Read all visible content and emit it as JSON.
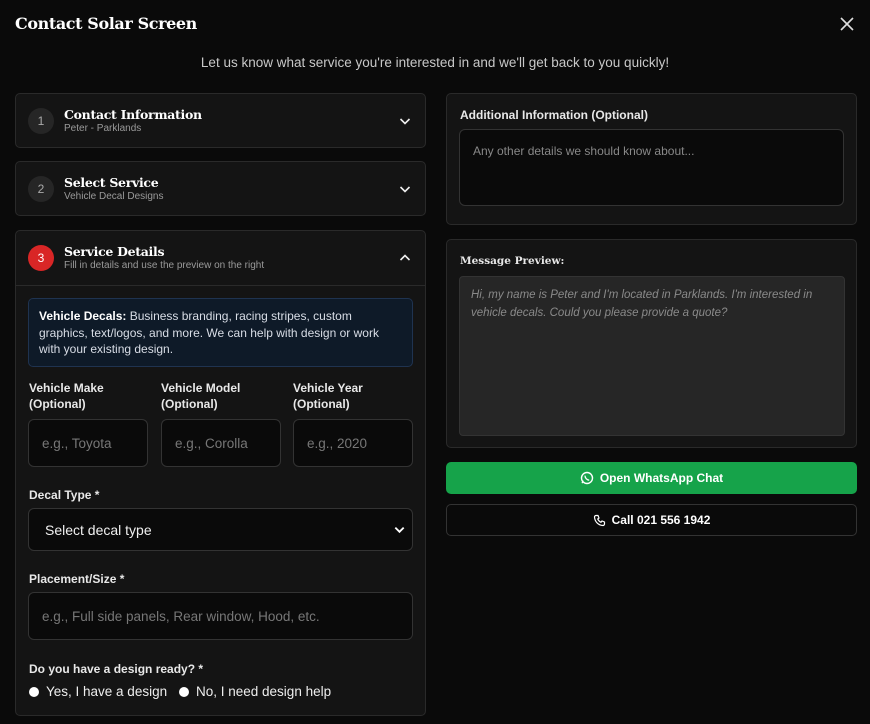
{
  "dialog": {
    "title": "Contact Solar Screen",
    "subtitle": "Let us know what service you're interested in and we'll get back to you quickly!"
  },
  "steps": [
    {
      "number": "1",
      "title": "Contact Information",
      "subtitle": "Peter - Parklands",
      "state": "collapsed"
    },
    {
      "number": "2",
      "title": "Select Service",
      "subtitle": "Vehicle Decal Designs",
      "state": "collapsed"
    },
    {
      "number": "3",
      "title": "Service Details",
      "subtitle": "Fill in details and use the preview on the right",
      "state": "expanded"
    }
  ],
  "service_details": {
    "info_heading": "Vehicle Decals:",
    "info_text": " Business branding, racing stripes, custom graphics, text/logos, and more. We can help with design or work with your existing design.",
    "vehicle_make": {
      "label_line1": "Vehicle Make",
      "label_line2": "(Optional)",
      "placeholder": "e.g., Toyota"
    },
    "vehicle_model": {
      "label_line1": "Vehicle Model",
      "label_line2": "(Optional)",
      "placeholder": "e.g., Corolla"
    },
    "vehicle_year": {
      "label_line1": "Vehicle Year",
      "label_line2": "(Optional)",
      "placeholder": "e.g., 2020"
    },
    "decal_type": {
      "label": "Decal Type *",
      "selected": "Select decal type"
    },
    "placement": {
      "label": "Placement/Size *",
      "placeholder": "e.g., Full side panels, Rear window, Hood, etc."
    },
    "design_ready": {
      "label": "Do you have a design ready? *",
      "options": [
        "Yes, I have a design",
        "No, I need design help"
      ]
    }
  },
  "additional_info": {
    "label": "Additional Information (Optional)",
    "placeholder": "Any other details we should know about..."
  },
  "message_preview": {
    "label": "Message Preview:",
    "text": "Hi, my name is Peter and I'm located in Parklands. I'm interested in vehicle decals. Could you please provide a quote?"
  },
  "actions": {
    "whatsapp": "Open WhatsApp Chat",
    "call": "Call 021 556 1942"
  },
  "colors": {
    "accent_red": "#d92626",
    "whatsapp_green": "#16a34a",
    "background": "#0a0a0a"
  },
  "icons": [
    "close-icon",
    "chevron-down-icon",
    "chevron-up-icon",
    "whatsapp-icon",
    "phone-icon"
  ]
}
